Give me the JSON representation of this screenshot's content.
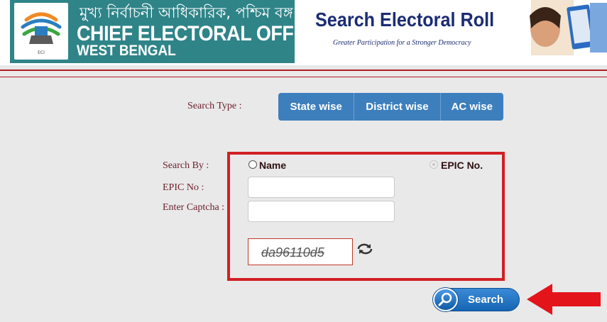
{
  "header": {
    "bengali_title": "মুখ্য নির্বাচনী আধিকারিক, পশ্চিম বঙ্গ",
    "title_line1": "CHIEF ELECTORAL OFFICER,",
    "title_line2": "WEST BENGAL",
    "page_title": "Search Electoral Roll",
    "tagline": "Greater Participation for a Stronger Democracy"
  },
  "search_type": {
    "label": "Search Type :",
    "tabs": [
      "State wise",
      "District wise",
      "AC wise"
    ]
  },
  "search_by": {
    "label": "Search By :",
    "options": [
      "Name",
      "EPIC No."
    ],
    "selected": "EPIC No."
  },
  "epic": {
    "label": "EPIC No :",
    "value": ""
  },
  "captcha": {
    "label": "Enter Captcha :",
    "value": "",
    "image_text": "da96110d5"
  },
  "search_button": {
    "label": "Search"
  },
  "icons": {
    "search": "magnifier-icon",
    "refresh": "refresh-icon",
    "arrow": "arrow-left-icon"
  },
  "colors": {
    "teal": "#2f8488",
    "tab_blue": "#3d7fbd",
    "highlight_red": "#d21f24",
    "label_maroon": "#6b1e2a"
  }
}
